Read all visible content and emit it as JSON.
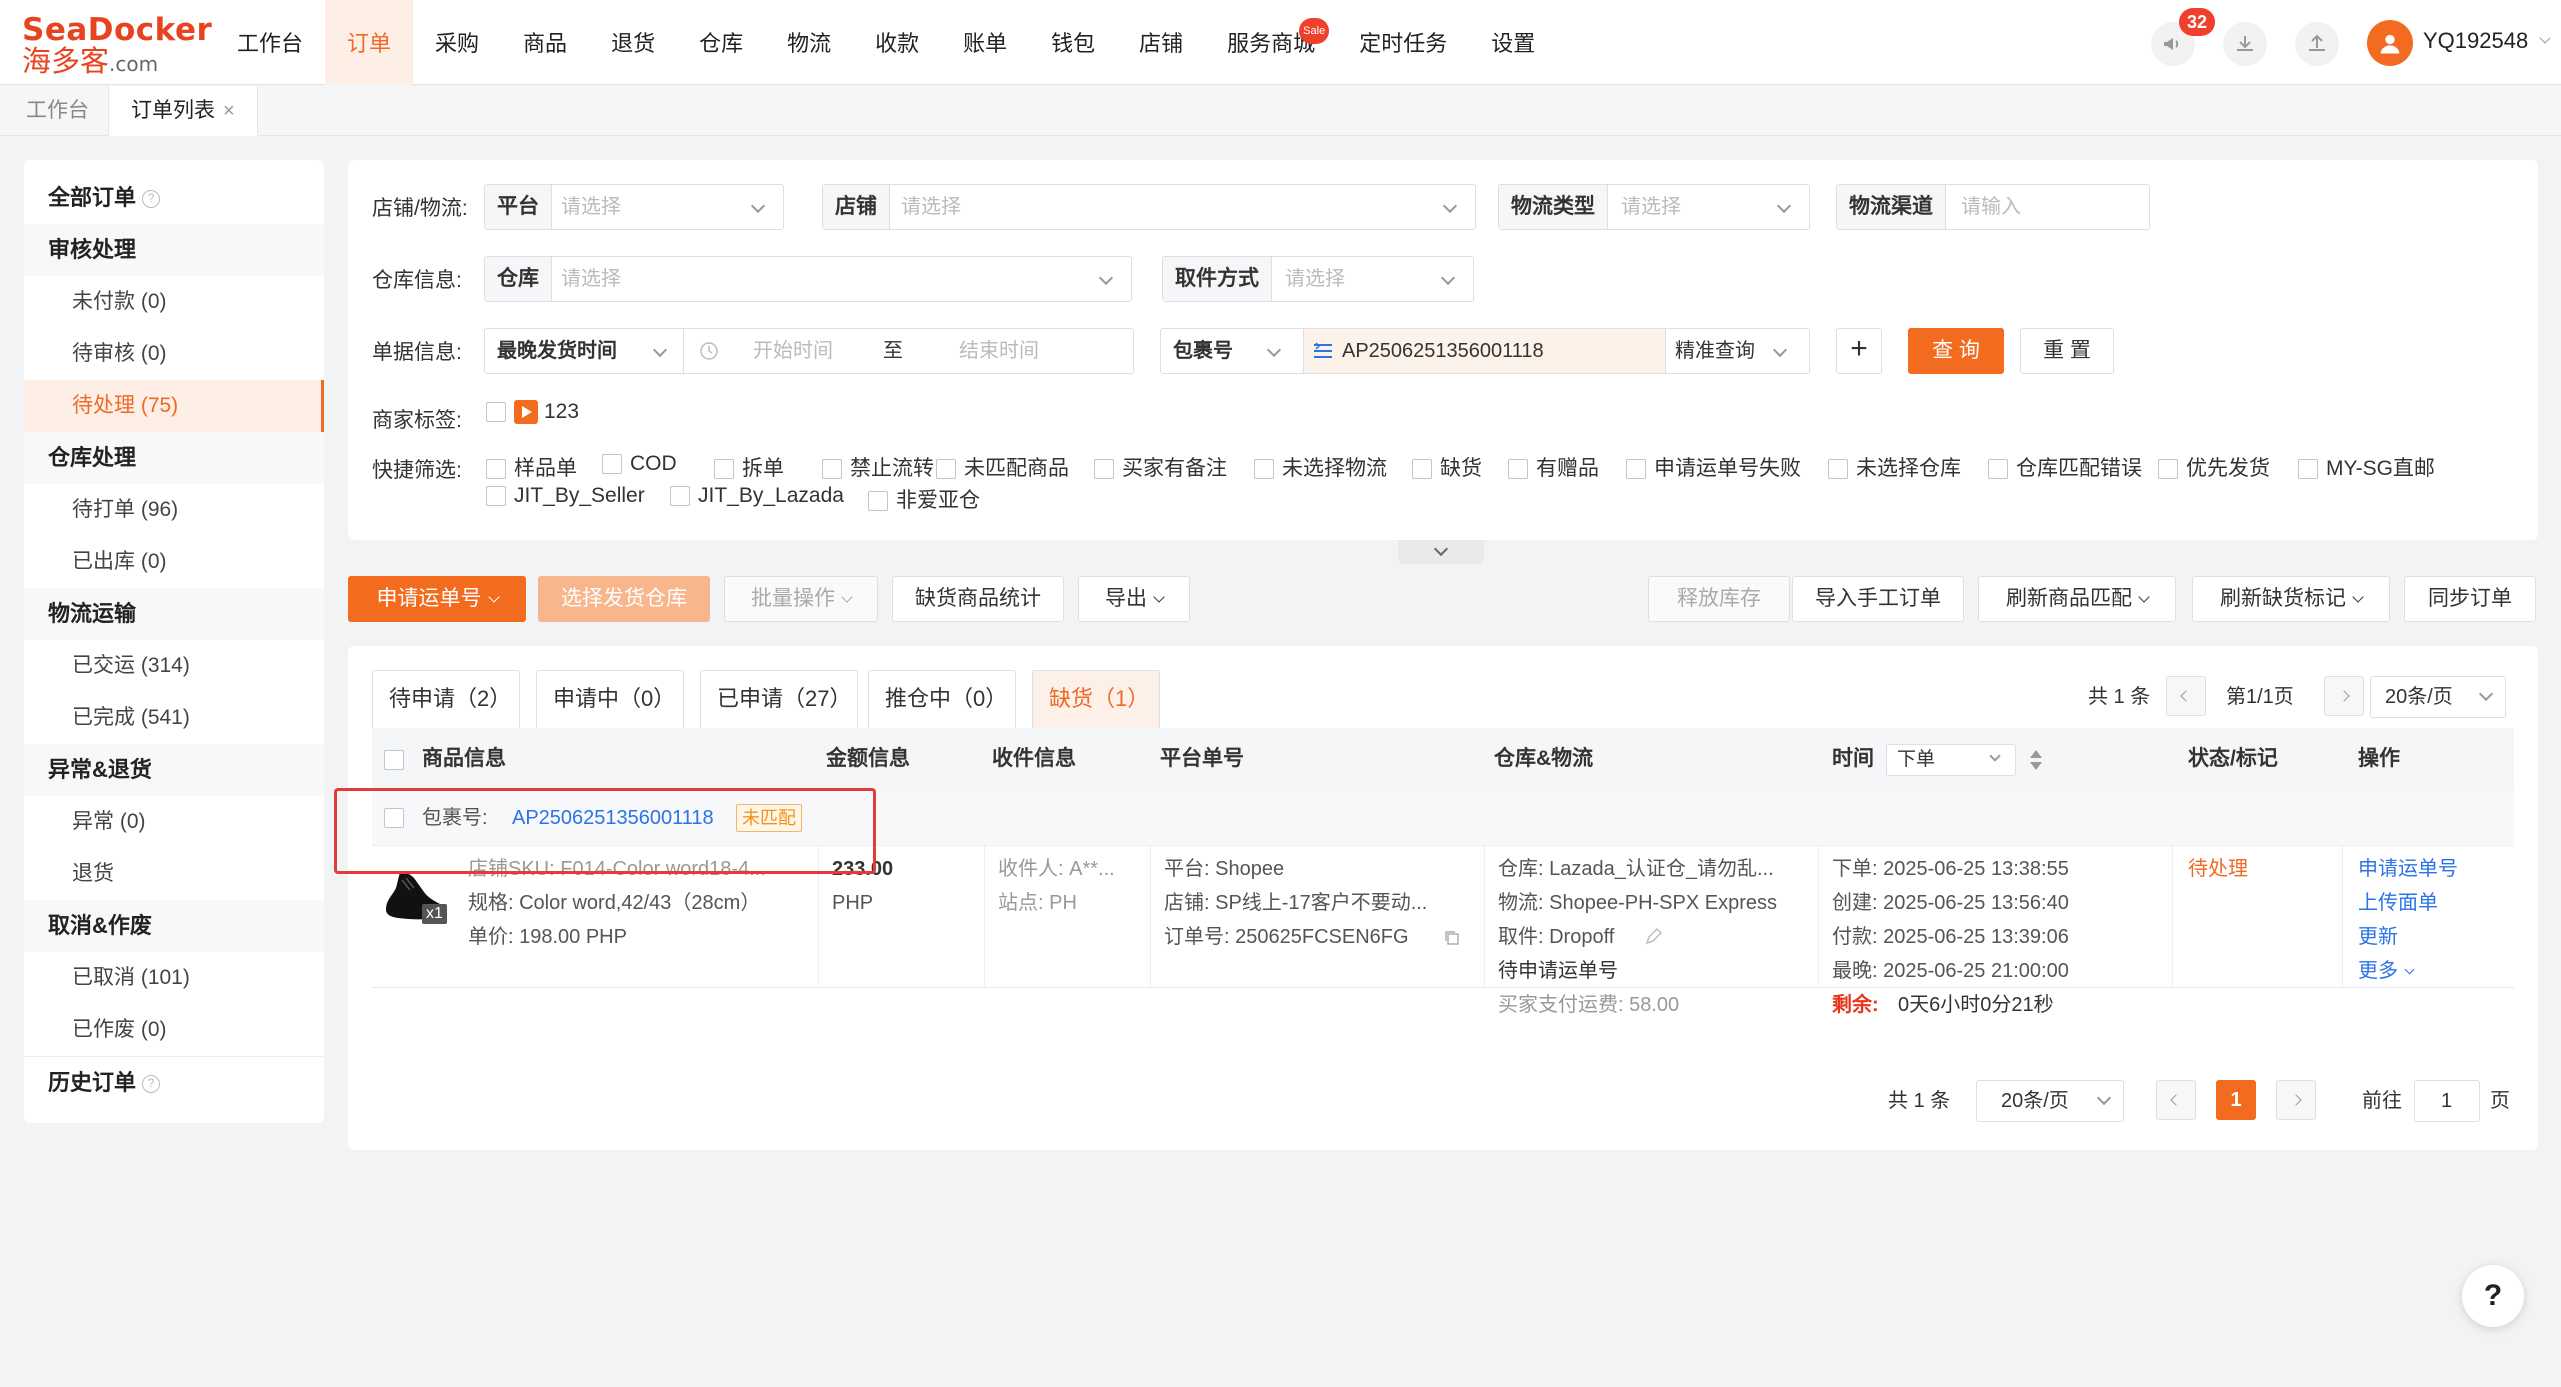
{
  "brand": {
    "line1_a": "Sea",
    "line1_b": "Docker",
    "line2_a": "海多客",
    "line2_b": ".com"
  },
  "nav": [
    {
      "label": "工作台"
    },
    {
      "label": "订单",
      "active": true
    },
    {
      "label": "采购"
    },
    {
      "label": "商品"
    },
    {
      "label": "退货"
    },
    {
      "label": "仓库"
    },
    {
      "label": "物流"
    },
    {
      "label": "收款"
    },
    {
      "label": "账单"
    },
    {
      "label": "钱包"
    },
    {
      "label": "店铺"
    },
    {
      "label": "服务商城",
      "badge": "Sale"
    },
    {
      "label": "定时任务"
    },
    {
      "label": "设置"
    }
  ],
  "header": {
    "notif_count": "32",
    "username": "YQ192548"
  },
  "page_tabs": [
    {
      "label": "工作台"
    },
    {
      "label": "订单列表",
      "close": "×"
    }
  ],
  "sidebar": {
    "groups": [
      {
        "label": "全部订单",
        "help": "?",
        "items": []
      },
      {
        "label": "审核处理",
        "items": [
          {
            "label": "未付款 (0)"
          },
          {
            "label": "待审核 (0)"
          },
          {
            "label": "待处理 (75)",
            "active": true
          }
        ]
      },
      {
        "label": "仓库处理",
        "items": [
          {
            "label": "待打单 (96)"
          },
          {
            "label": "已出库 (0)"
          }
        ]
      },
      {
        "label": "物流运输",
        "items": [
          {
            "label": "已交运 (314)"
          },
          {
            "label": "已完成 (541)"
          }
        ]
      },
      {
        "label": "异常&退货",
        "items": [
          {
            "label": "异常 (0)"
          },
          {
            "label": "退货"
          }
        ]
      },
      {
        "label": "取消&作废",
        "items": [
          {
            "label": "已取消 (101)"
          },
          {
            "label": "已作废 (0)"
          }
        ]
      },
      {
        "label": "历史订单",
        "help": "?",
        "items": []
      }
    ]
  },
  "filters": {
    "shop_logistics_label": "店铺/物流:",
    "platform_tag": "平台",
    "platform_ph": "请选择",
    "shop_tag": "店铺",
    "shop_ph": "请选择",
    "logistics_type_tag": "物流类型",
    "logistics_type_ph": "请选择",
    "channel_tag": "物流渠道",
    "channel_ph": "请输入",
    "warehouse_label": "仓库信息:",
    "warehouse_tag": "仓库",
    "warehouse_ph": "请选择",
    "pickup_tag": "取件方式",
    "pickup_ph": "请选择",
    "doc_label": "单据信息:",
    "time_type": "最晚发货时间",
    "start_ph": "开始时间",
    "to": "至",
    "end_ph": "结束时间",
    "pkg_type": "包裹号",
    "pkg_value": "AP2506251356001118",
    "match_mode": "精准查询",
    "plus": "+",
    "search": "查 询",
    "reset": "重 置",
    "merchant_tag_label": "商家标签:",
    "merchant_tag_value": "123",
    "quick_label": "快捷筛选:",
    "quick_row1": [
      "样品单",
      "COD",
      "拆单",
      "禁止流转",
      "未匹配商品",
      "买家有备注",
      "未选择物流",
      "缺货",
      "有赠品",
      "申请运单号失败",
      "未选择仓库",
      "仓库匹配错误",
      "优先发货",
      "MY-SG直邮"
    ],
    "quick_row2": [
      "JIT_By_Seller",
      "JIT_By_Lazada",
      "非爱亚仓"
    ]
  },
  "actions": {
    "apply_waybill": "申请运单号",
    "select_warehouse": "选择发货仓库",
    "batch": "批量操作",
    "stockout_stats": "缺货商品统计",
    "export": "导出",
    "release_stock": "释放库存",
    "import_manual": "导入手工订单",
    "refresh_match": "刷新商品匹配",
    "refresh_stockout": "刷新缺货标记",
    "sync": "同步订单"
  },
  "status_tabs": [
    {
      "label": "待申请（2）"
    },
    {
      "label": "申请中（0）"
    },
    {
      "label": "已申请（27）"
    },
    {
      "label": "推仓中（0）"
    },
    {
      "label": "缺货（1）",
      "active": true
    }
  ],
  "pager_top": {
    "total": "共 1 条",
    "page": "第1/1页",
    "per_page": "20条/页"
  },
  "table": {
    "headers": {
      "product": "商品信息",
      "amount": "金额信息",
      "receiver": "收件信息",
      "platform_no": "平台单号",
      "wh_logistics": "仓库&物流",
      "time": "时间",
      "time_select": "下单",
      "status": "状态/标记",
      "ops": "操作"
    },
    "group": {
      "pkg_label": "包裹号:",
      "pkg_no": "AP2506251356001118",
      "badge": "未匹配"
    },
    "row": {
      "qty": "x1",
      "sku": "店铺SKU:  F014-Color word18-4...",
      "spec": "规格:  Color word,42/43（28cm）",
      "price": "单价:  198.00 PHP",
      "amount": "233.00",
      "currency": "PHP",
      "receiver": "收件人:  A**...",
      "site": "站点:  PH",
      "platform": "平台:  Shopee",
      "shop": "店铺:  SP线上-17客户不要动...",
      "order_no": "订单号:  250625FCSEN6FG",
      "warehouse": "仓库:  Lazada_认证仓_请勿乱...",
      "logistics": "物流:  Shopee-PH-SPX Express",
      "pickup": "取件:  Dropoff",
      "waybill_status": "待申请运单号",
      "buyer_freight": "买家支付运费:  58.00",
      "t_order": "下单:  2025-06-25 13:38:55",
      "t_create": "创建:  2025-06-25 13:56:40",
      "t_pay": "付款:  2025-06-25 13:39:06",
      "t_latest": "最晚:  2025-06-25 21:00:00",
      "t_remain_label": "剩余:",
      "t_remain": "0天6小时0分21秒",
      "status": "待处理",
      "ops": [
        "申请运单号",
        "上传面单",
        "更新",
        "更多"
      ]
    }
  },
  "pager_bottom": {
    "total": "共 1 条",
    "per_page": "20条/页",
    "current": "1",
    "goto": "前往",
    "goto_val": "1",
    "page_unit": "页"
  },
  "help": "?",
  "colors": {
    "accent": "#f26b1f",
    "link": "#2b73e6",
    "highlight": "#e53a3a"
  }
}
